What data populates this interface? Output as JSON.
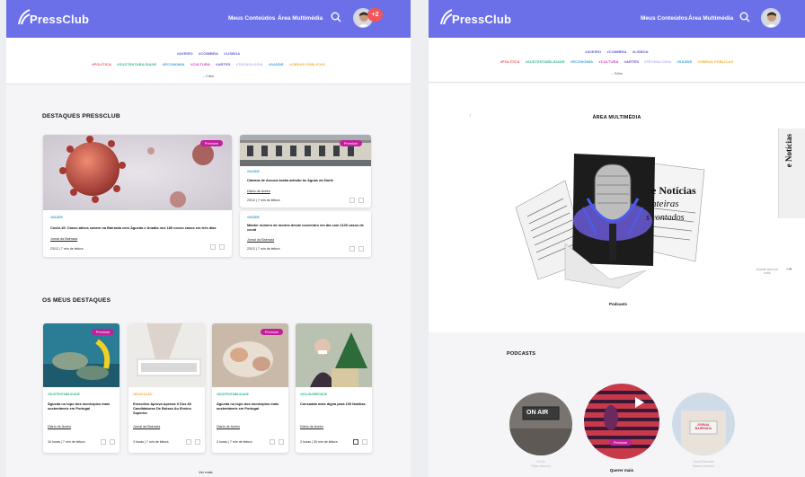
{
  "brand": {
    "name": "PressClub"
  },
  "nav": {
    "conteudos": "Meus Conteúdos",
    "multimedia": "Área Multimédia"
  },
  "notifications": {
    "count": "+2"
  },
  "tags": {
    "row1": [
      {
        "label": "#AVEIRO",
        "color": "#5a5fd8"
      },
      {
        "label": "#COIMBRA",
        "color": "#5a5fd8"
      },
      {
        "label": "#LISBOA",
        "color": "#5a5fd8"
      }
    ],
    "row2": [
      {
        "label": "#POLÍTICA",
        "color": "#e8545a"
      },
      {
        "label": "#SUSTENTABILIDADE",
        "color": "#35b88c"
      },
      {
        "label": "#ECONOMIA",
        "color": "#3aa0d8"
      },
      {
        "label": "#CULTURA",
        "color": "#d13fbb"
      },
      {
        "label": "#ARTES",
        "color": "#6b4fd8"
      },
      {
        "label": "#TECNOLOGIA",
        "color": "#b5b0f0"
      },
      {
        "label": "#SAÚDE",
        "color": "#3aa0d8"
      },
      {
        "label": "#OBRAS PÚBLICAS",
        "color": "#f0b030"
      }
    ],
    "expand_label": "Editar"
  },
  "destaques": {
    "title": "DESTAQUES PRESSCLUB",
    "main": {
      "premium": "Premium",
      "tag": "#SAÚDE",
      "title": "Covid-19: Casos ativos sobem na Bairrada com Águeda e Anadia nos 180 novos casos em três dias",
      "source": "Jornal da Bairrada",
      "meta": "23/12 | 7 min de leitura"
    },
    "side": [
      {
        "premium": "Premium",
        "tag": "#SAÚDE",
        "title": "Câmara de Arouca avalia adesão às Águas do Norte",
        "source": "Diário de Aveiro",
        "meta": "23/12 | 7 min de leitura"
      },
      {
        "tag": "#SAÚDE",
        "title": "Manter número de mortes desde novembro em dia com 1100 casos de covid",
        "source": "Jornal da Bairrada",
        "meta": "23/12 | 7 min de leitura"
      }
    ]
  },
  "meus": {
    "title": "OS MEUS DESTAQUES",
    "items": [
      {
        "premium": "Premium",
        "tag": "#SUSTENTABILIDADE",
        "tag_color": "#35b88c",
        "title": "Águeda no topo dos municípios mais sustentáveis em Portugal",
        "source": "Diário de Aveiro",
        "meta": "34 horas | 7 min de leitura"
      },
      {
        "premium": "",
        "tag": "#EDUCAÇÃO",
        "tag_color": "#f0b030",
        "title": "Executivo Aprova Apenas 9 Dos 83 Candidaturas De Bolsas Ao Ensino Superior",
        "source": "Jornal da Bairrada",
        "meta": "3 horas | 7 min de leitura"
      },
      {
        "premium": "Premium",
        "tag": "#SUSTENTABILIDADE",
        "tag_color": "#35b88c",
        "title": "Águeda no topo dos municípios mais sustentáveis em Portugal",
        "source": "Diário de Aveiro",
        "meta": "3 horas | 7 min de leitura"
      },
      {
        "premium": "",
        "tag": "#SOLIDARIEDADE",
        "tag_color": "#35b88c",
        "title": "Consoada mais digna para 100 famílias",
        "source": "Diário de Aveiro",
        "meta": "3 horas | 30 min de leitura"
      }
    ],
    "see_more": "Ver mais"
  },
  "multimedia": {
    "title": "ÁREA MULTIMÉDIA",
    "caption": "Podcasts",
    "next_label": "Arraste para ver mais",
    "headlines": [
      "e Notícias",
      "nteiras",
      "s contados"
    ]
  },
  "podcasts": {
    "title": "PODCASTS",
    "items": [
      {
        "label": "On Air",
        "sub": "Filipe Antunes",
        "premium": "",
        "sign": "ON AIR"
      },
      {
        "label": "Querer mais",
        "sub": "",
        "premium": "Premium",
        "sign": ""
      },
      {
        "label": "Jornal Bairrada",
        "sub": "Manuel Antunes",
        "premium": "",
        "sign": "JORNAL BAIRRADA"
      }
    ]
  }
}
